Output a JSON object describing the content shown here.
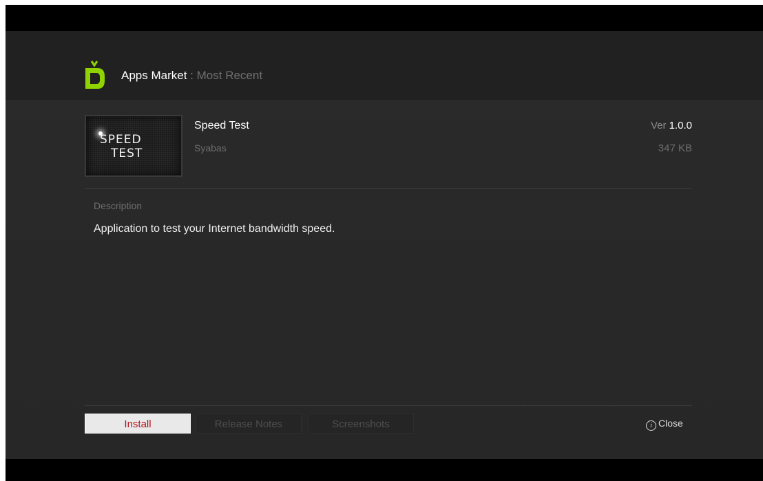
{
  "header": {
    "app_title": "Apps Market",
    "separator": ":",
    "section": "Most Recent"
  },
  "app": {
    "name": "Speed Test",
    "developer": "Syabas",
    "version_label": "Ver",
    "version": "1.0.0",
    "size": "347 KB",
    "thumbnail_line1": "SPEED",
    "thumbnail_line2": "TEST"
  },
  "description": {
    "label": "Description",
    "text": "Application to test your Internet bandwidth speed."
  },
  "tabs": [
    {
      "label": "Install",
      "active": true
    },
    {
      "label": "Release Notes",
      "active": false
    },
    {
      "label": "Screenshots",
      "active": false
    }
  ],
  "close": {
    "icon": "info-icon",
    "label": "Close"
  },
  "colors": {
    "logo_green": "#8fd400",
    "install_text": "#b0181e"
  }
}
